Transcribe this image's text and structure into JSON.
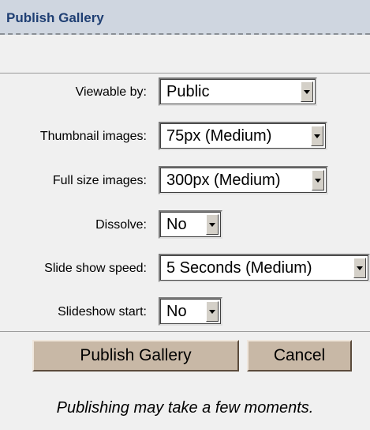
{
  "header": {
    "title": "Publish Gallery"
  },
  "form": {
    "fields": [
      {
        "label": "Viewable by:",
        "value": "Public"
      },
      {
        "label": "Thumbnail images:",
        "value": "75px (Medium)"
      },
      {
        "label": "Full size images:",
        "value": "300px (Medium)"
      },
      {
        "label": "Dissolve:",
        "value": "No"
      },
      {
        "label": "Slide show speed:",
        "value": "5 Seconds (Medium)"
      },
      {
        "label": "Slideshow start:",
        "value": "No"
      }
    ]
  },
  "buttons": {
    "publish_label": "Publish Gallery",
    "cancel_label": "Cancel"
  },
  "footer": {
    "note": "Publishing may take a few moments."
  },
  "colors": {
    "header_bg": "#cfd6e0",
    "header_text": "#1f3f73",
    "panel_bg": "#f0f0f0",
    "button_bg": "#c8b8a6"
  }
}
